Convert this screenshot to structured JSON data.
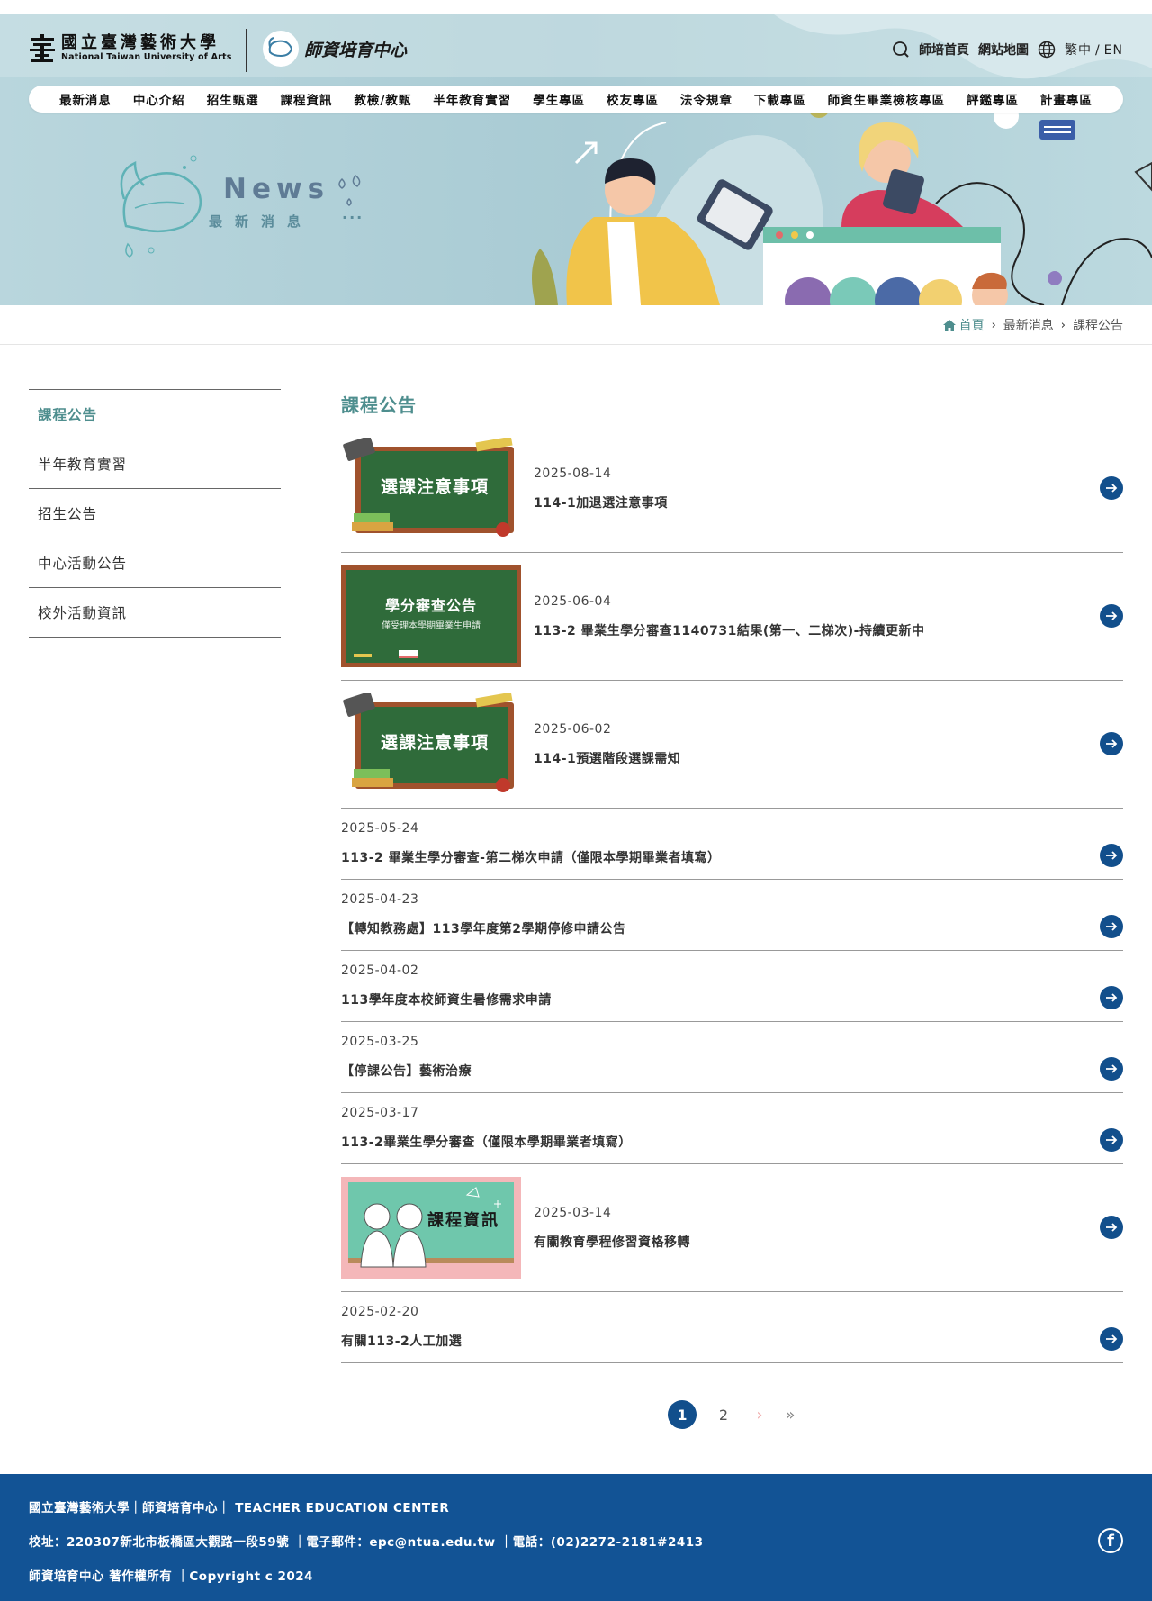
{
  "header": {
    "university_zh": "國立臺灣藝術大學",
    "university_en": "National Taiwan University of Arts",
    "center_logo_text": "師資培育中心",
    "toplinks": {
      "home": "師培首頁",
      "sitemap": "網站地圖",
      "lang_zh": "繁中",
      "lang_sep": "/",
      "lang_en": "EN"
    },
    "nav": [
      "最新消息",
      "中心介紹",
      "招生甄選",
      "課程資訊",
      "教檢/教甄",
      "半年教育實習",
      "學生專區",
      "校友專區",
      "法令規章",
      "下載專區",
      "師資生畢業檢核專區",
      "評鑑專區",
      "計畫專區"
    ]
  },
  "banner": {
    "title": "News",
    "subtitle": "最新消息",
    "dots": "···"
  },
  "breadcrumb": {
    "home": "首頁",
    "level1": "最新消息",
    "level2": "課程公告"
  },
  "sidebar": {
    "items": [
      {
        "label": "課程公告",
        "active": true
      },
      {
        "label": "半年教育實習"
      },
      {
        "label": "招生公告"
      },
      {
        "label": "中心活動公告"
      },
      {
        "label": "校外活動資訊"
      }
    ]
  },
  "main": {
    "title": "課程公告",
    "items": [
      {
        "date": "2025-08-14",
        "title": "114-1加退選注意事項",
        "image": "選課注意事項"
      },
      {
        "date": "2025-06-04",
        "title": "113-2 畢業生學分審查1140731結果(第一、二梯次)-持續更新中",
        "image": "學分審查公告",
        "image_sub": "僅受理本學期畢業生申請"
      },
      {
        "date": "2025-06-02",
        "title": "114-1預選階段選課需知",
        "image": "選課注意事項"
      },
      {
        "date": "2025-05-24",
        "title": "113-2 畢業生學分審查-第二梯次申請（僅限本學期畢業者填寫）"
      },
      {
        "date": "2025-04-23",
        "title": "【轉知教務處】113學年度第2學期停修申請公告"
      },
      {
        "date": "2025-04-02",
        "title": "113學年度本校師資生暑修需求申請"
      },
      {
        "date": "2025-03-25",
        "title": "【停課公告】藝術治療"
      },
      {
        "date": "2025-03-17",
        "title": "113-2畢業生學分審查（僅限本學期畢業者填寫）"
      },
      {
        "date": "2025-03-14",
        "title": "有關教育學程修習資格移轉",
        "image": "課程資訊"
      },
      {
        "date": "2025-02-20",
        "title": "有關113-2人工加選"
      }
    ]
  },
  "pagination": {
    "current": "1",
    "next_page": "2",
    "next": "›",
    "last": "»"
  },
  "footer": {
    "line1": "國立臺灣藝術大學｜師資培育中心｜ TEACHER EDUCATION CENTER",
    "line2": "校址：220307新北市板橋區大觀路一段59號  ｜電子郵件：epc@ntua.edu.tw ｜電話：(02)2272-2181#2413",
    "line3": "師資培育中心 著作權所有 ｜Copyright c 2024",
    "facebook": "f"
  },
  "colors": {
    "teal": "#4e8e8e",
    "navy": "#124f8c",
    "footer": "#125395",
    "banner": "#aecfd8"
  }
}
